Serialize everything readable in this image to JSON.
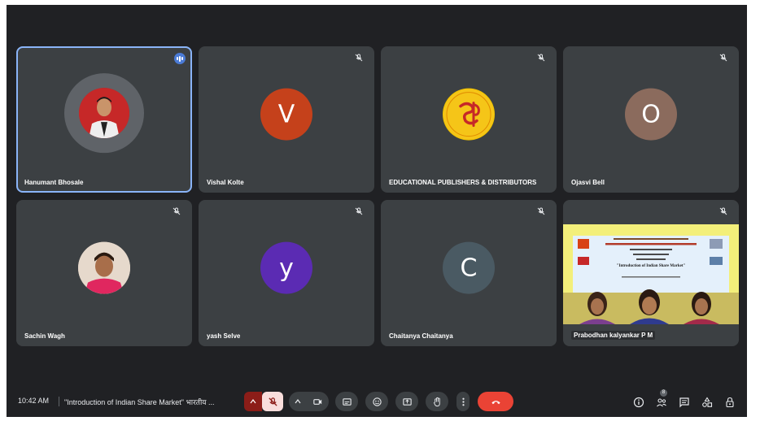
{
  "colors": {
    "background": "#202124",
    "tile": "#3c4043",
    "speaking_outline": "#8ab4f8",
    "end_call": "#ea4335"
  },
  "participants": [
    {
      "name": "Hanumant Bhosale",
      "avatar": "photo",
      "speaking": true
    },
    {
      "name": "Vishal Kolte",
      "initial": "V",
      "avatar_color": "#c5411b",
      "muted": true
    },
    {
      "name": "EDUCATIONAL PUBLISHERS & DISTRIBUTORS",
      "avatar": "logo",
      "muted": true
    },
    {
      "name": "Ojasvi Bell",
      "initial": "O",
      "avatar_color": "#8b6b5d",
      "muted": true
    },
    {
      "name": "Sachin Wagh",
      "avatar": "photo",
      "muted": true
    },
    {
      "name": "yash Selve",
      "initial": "y",
      "avatar_color": "#5b2bb3",
      "muted": true
    },
    {
      "name": "Chaitanya Chaitanya",
      "initial": "C",
      "avatar_color": "#4a5a63",
      "muted": true
    },
    {
      "name": "Prabodhan kalyankar P M",
      "avatar": "video",
      "muted": true
    }
  ],
  "slide": {
    "title": "\"Introduction of Indian Share Market\""
  },
  "bottombar": {
    "time": "10:42 AM",
    "meeting_title": "\"Introduction of Indian Share Market\" भारतीय ...",
    "people_count": "8"
  }
}
